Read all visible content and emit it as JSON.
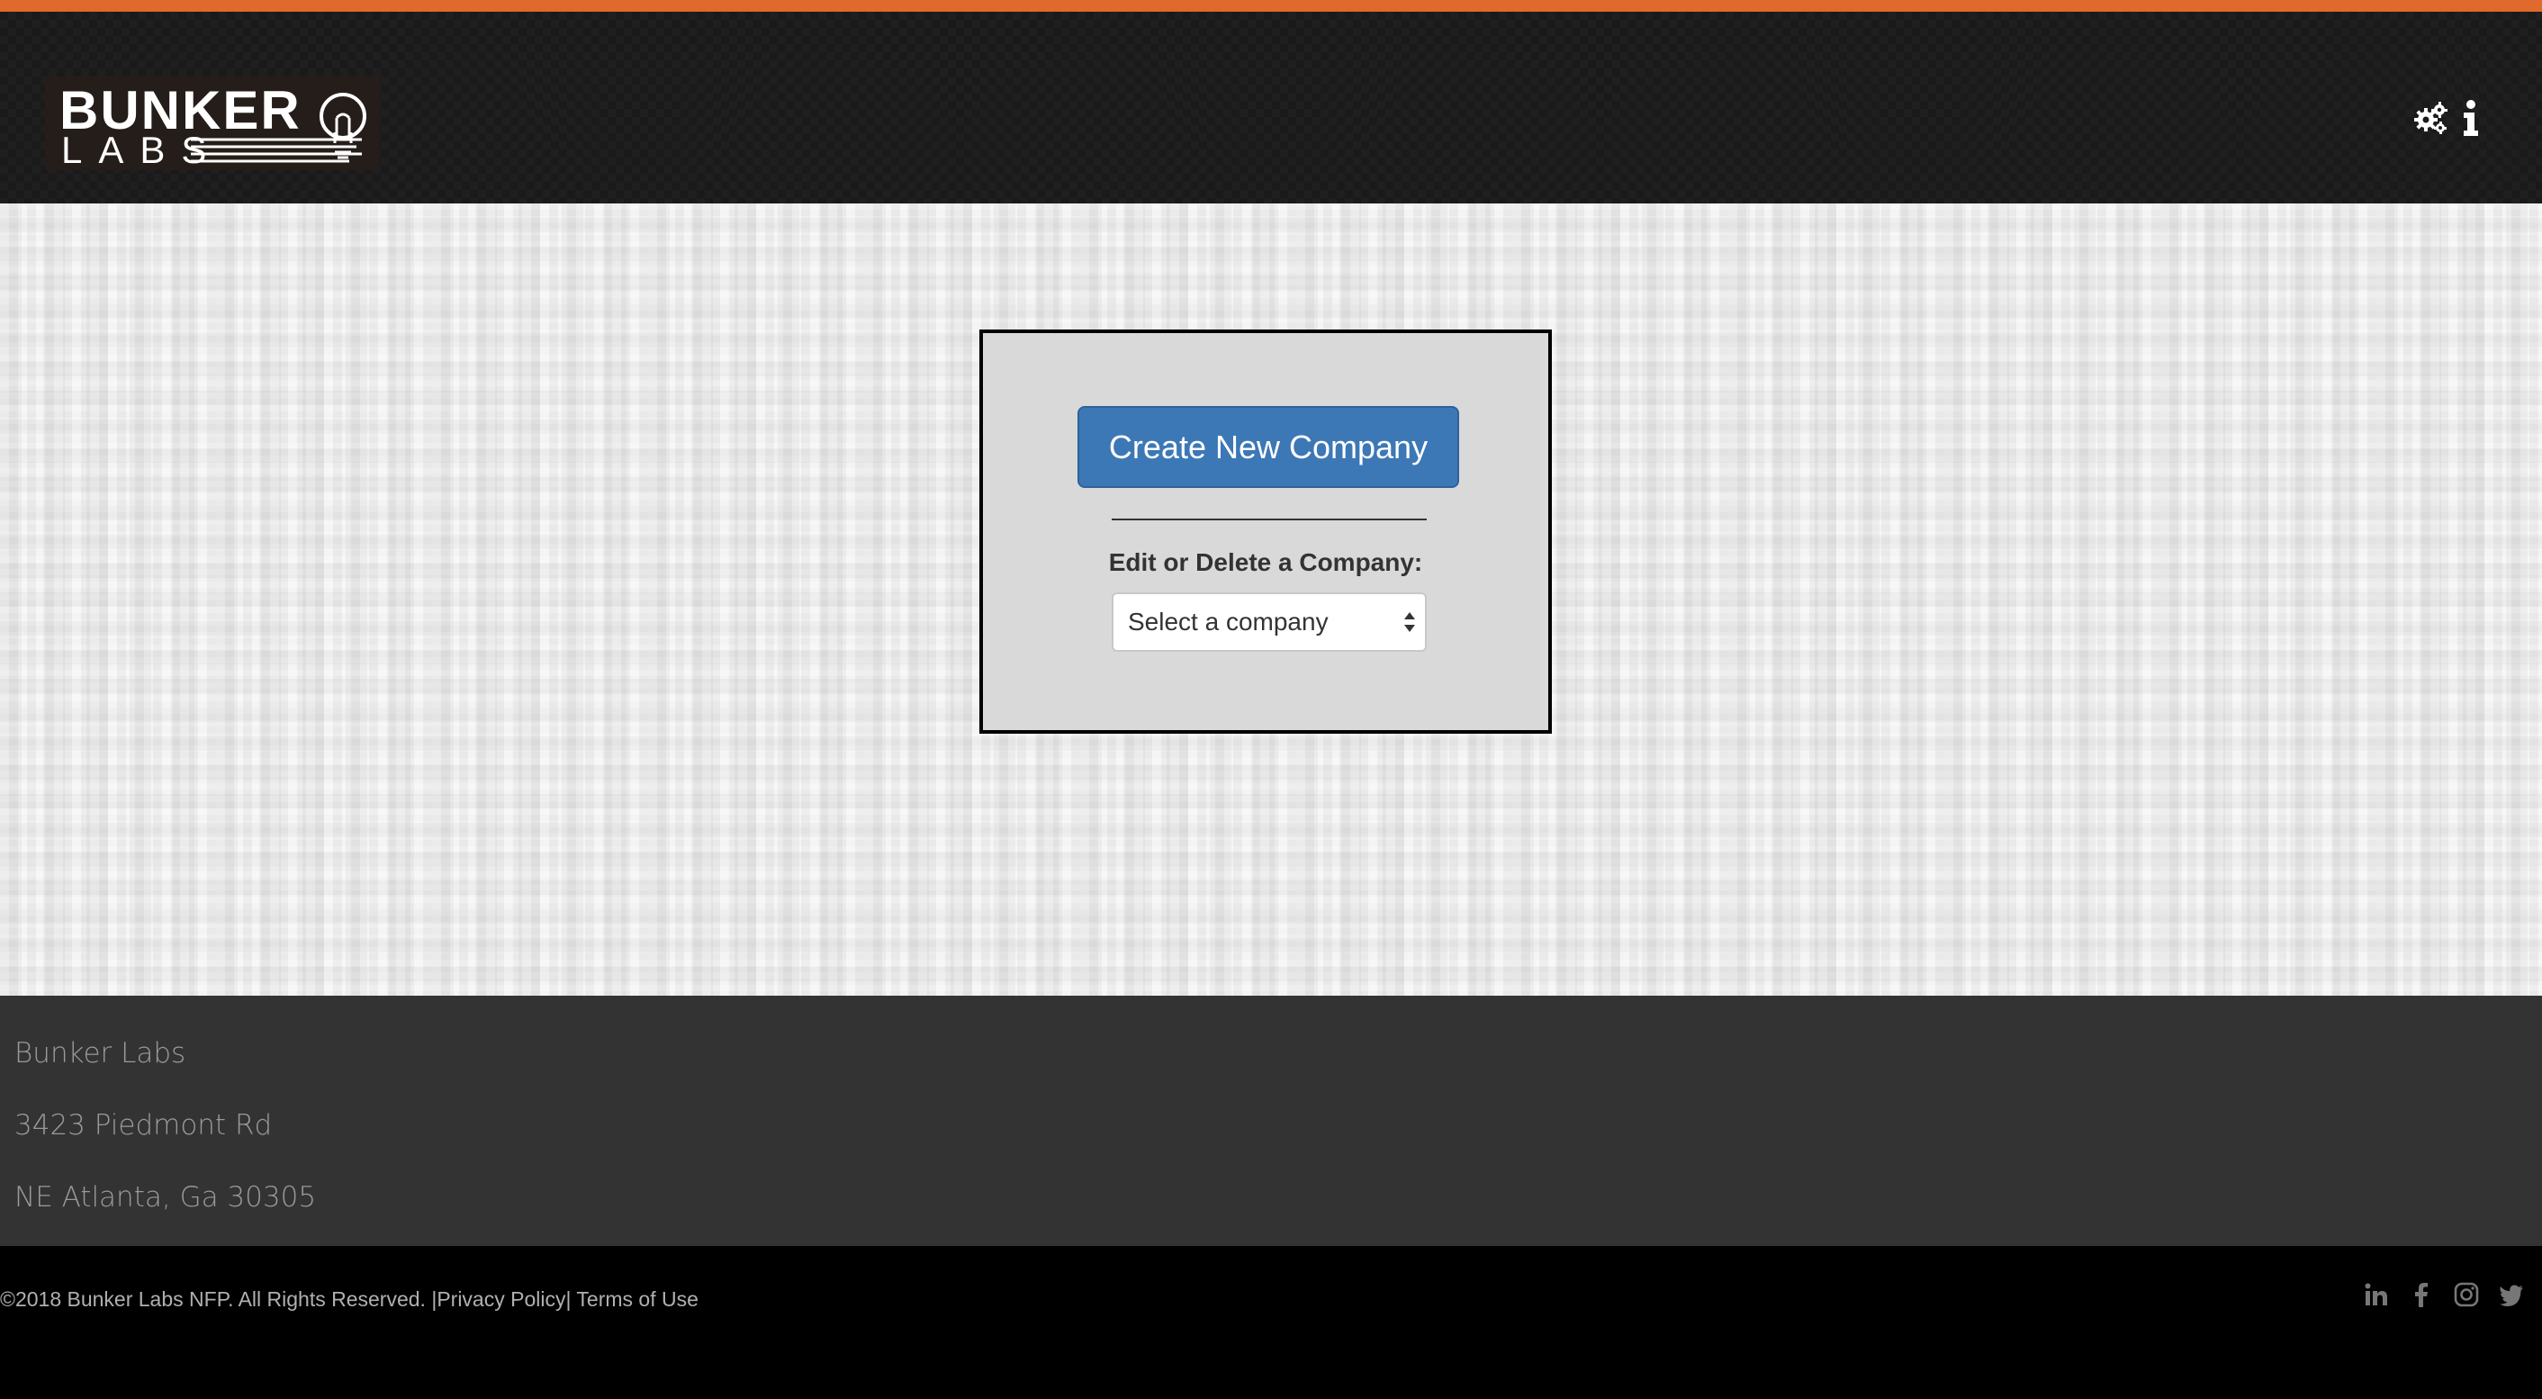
{
  "brand": {
    "logo_line1": "BUNKER",
    "logo_line2": "LABS",
    "accent_color": "#e0692d"
  },
  "nav": {
    "icons": [
      "settings-gears-icon",
      "info-icon"
    ]
  },
  "panel": {
    "create_button_label": "Create New Company",
    "edit_label": "Edit or Delete a Company:",
    "select_value": "Select a company",
    "button_color": "#3d78b6"
  },
  "footer": {
    "name": "Bunker Labs",
    "address_line1": "3423 Piedmont Rd",
    "address_line2": "NE Atlanta, Ga 30305",
    "copyright": "©2018 Bunker Labs NFP. All Rights Reserved. |",
    "privacy_link": "Privacy Policy",
    "separator": "| ",
    "terms_link": "Terms of Use",
    "social_icons": [
      "linkedin-icon",
      "facebook-icon",
      "instagram-icon",
      "twitter-icon"
    ]
  }
}
